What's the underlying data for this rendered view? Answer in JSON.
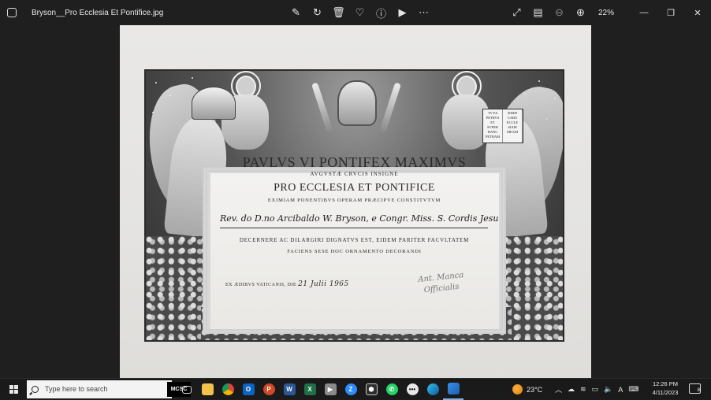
{
  "window": {
    "title": "Bryson__Pro Ecclesia Et Pontifice.jpg",
    "zoom": "22%",
    "toolbar_icons": [
      "edit-image-icon",
      "rotate-icon",
      "delete-icon",
      "favorite-icon",
      "info-icon",
      "slideshow-icon",
      "more-icon"
    ],
    "right_icons": [
      "expand-icon",
      "filmstrip-icon",
      "zoom-out-icon",
      "zoom-in-icon"
    ]
  },
  "certificate": {
    "heading": "PAVLVS VI PONTIFEX MAXIMVS",
    "sub1": "AVGVSTÆ CRVCIS INSIGNE",
    "award": "PRO ECCLESIA ET PONTIFICE",
    "sub2": "EXIMIAM PONENTIBVS OPERAM PRÆCIPVE CONSTITVTVM",
    "recipient": "Rev. do D.no Arcibaldo W. Bryson, e Congr. Miss. S. Cordis Jesu",
    "line3": "DECERNERE AC DILARGIRI DIGNATVS EST, EIDEM PARITER FACVLTATEM",
    "line4": "FACIENS SESE HOC ORNAMENTO DECORANDI",
    "date_prefix": "EX ÆDIBVS VATICANIS, DIE",
    "date_handwritten": "21 Julii 1965",
    "signature_line1": "Ant. Manca",
    "signature_line2": "Officialis",
    "book_left": "TV ES PETRVS ET SVPER HANC PETRAM",
    "book_right": "ÆDIFI CABO ECCLE SIAM MEAM"
  },
  "taskbar": {
    "search_placeholder": "Type here to search",
    "search_badge": "MCSC",
    "weather_temp": "23°C",
    "time": "12:26 PM",
    "date": "4/11/2023",
    "notification_count": "8",
    "language": "A"
  }
}
